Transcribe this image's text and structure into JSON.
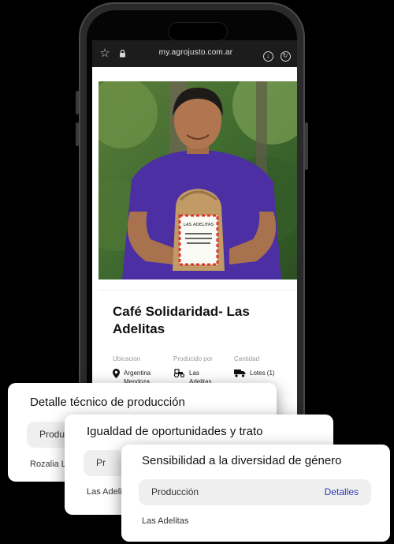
{
  "browser": {
    "url": "my.agrojusto.com.ar",
    "icons": [
      "star-icon",
      "lock-icon",
      "download-icon",
      "refresh-icon"
    ]
  },
  "product": {
    "title": "Café Solidaridad- Las Adelitas",
    "photo_bag_text": "LAS ADELITAS",
    "details": [
      {
        "label": "Ubicacion",
        "value_line1": "Argentina",
        "value_line2": "Mendoza",
        "icon": "location-pin-icon"
      },
      {
        "label": "Producido por",
        "value_line1": "Las",
        "value_line2": "Adelitas",
        "icon": "tractor-icon"
      },
      {
        "label": "Cantidad",
        "value_line1": "Lotes (1)",
        "value_line2": "",
        "icon": "truck-icon"
      }
    ]
  },
  "cards": [
    {
      "title": "Detalle técnico de producción",
      "pill_label": "Produc",
      "sub": "Rozalia L"
    },
    {
      "title": "Igualdad de oportunidades y trato",
      "pill_label": "Pr",
      "sub": "Las Adeli"
    },
    {
      "title": "Sensibilidad a la diversidad de género",
      "pill_label": "Producción",
      "link": "Detalles",
      "sub": "Las Adelitas"
    }
  ],
  "colors": {
    "link": "#2c3bb5",
    "pill": "#efefef",
    "shirt": "#4b2fa3",
    "urlbar": "#1c1c1c"
  }
}
